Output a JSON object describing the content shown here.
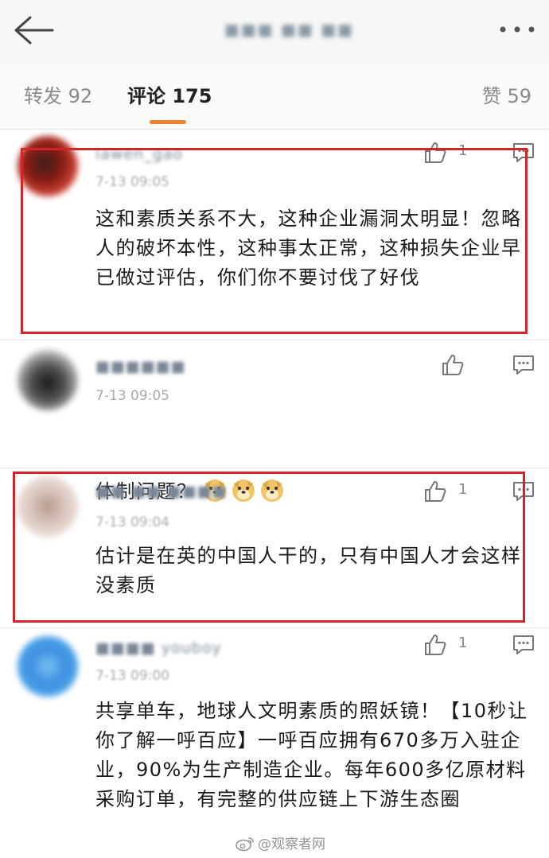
{
  "header": {
    "title_blurred": "■■■ ■■ ■■"
  },
  "tabs": {
    "repost_label": "转发",
    "repost_count": "92",
    "comments_label": "评论",
    "comments_count": "175",
    "likes_label": "赞",
    "likes_count": "59",
    "active": "comments",
    "accent": "#f08232"
  },
  "comments": [
    {
      "username": "lawen_gao",
      "time": "7-13 09:05",
      "text": "这和素质关系不大，这种企业漏洞太明显！忽略人的破坏本性，这种事太正常，这种损失企业早已做过评估，你们你不要讨伐了好伐",
      "likes": "1",
      "highlighted": true
    },
    {
      "username": "■■■■■■",
      "time": "7-13 09:05",
      "text": "体制问题？",
      "emoji": [
        "doge-icon",
        "doge-icon",
        "doge-icon"
      ],
      "likes": "",
      "highlighted": false
    },
    {
      "username": "■■ ■■ ■■■■",
      "time": "7-13 09:04",
      "text": "估计是在英的中国人干的，只有中国人才会这样没素质",
      "likes": "1",
      "highlighted": true
    },
    {
      "username": "■■■■ youboy",
      "time": "7-13 09:00",
      "text": "共享单车，地球人文明素质的照妖镜！【10秒让你了解一呼百应】一呼百应拥有670多万入驻企业，90%为生产制造企业。每年600多亿原材料采购订单，有完整的供应链上下游生态圈",
      "likes": "1",
      "highlighted": false
    }
  ],
  "watermark": "@观察者网",
  "colors": {
    "highlight_box": "#d0262a",
    "muted_text": "#8a8a8a"
  }
}
